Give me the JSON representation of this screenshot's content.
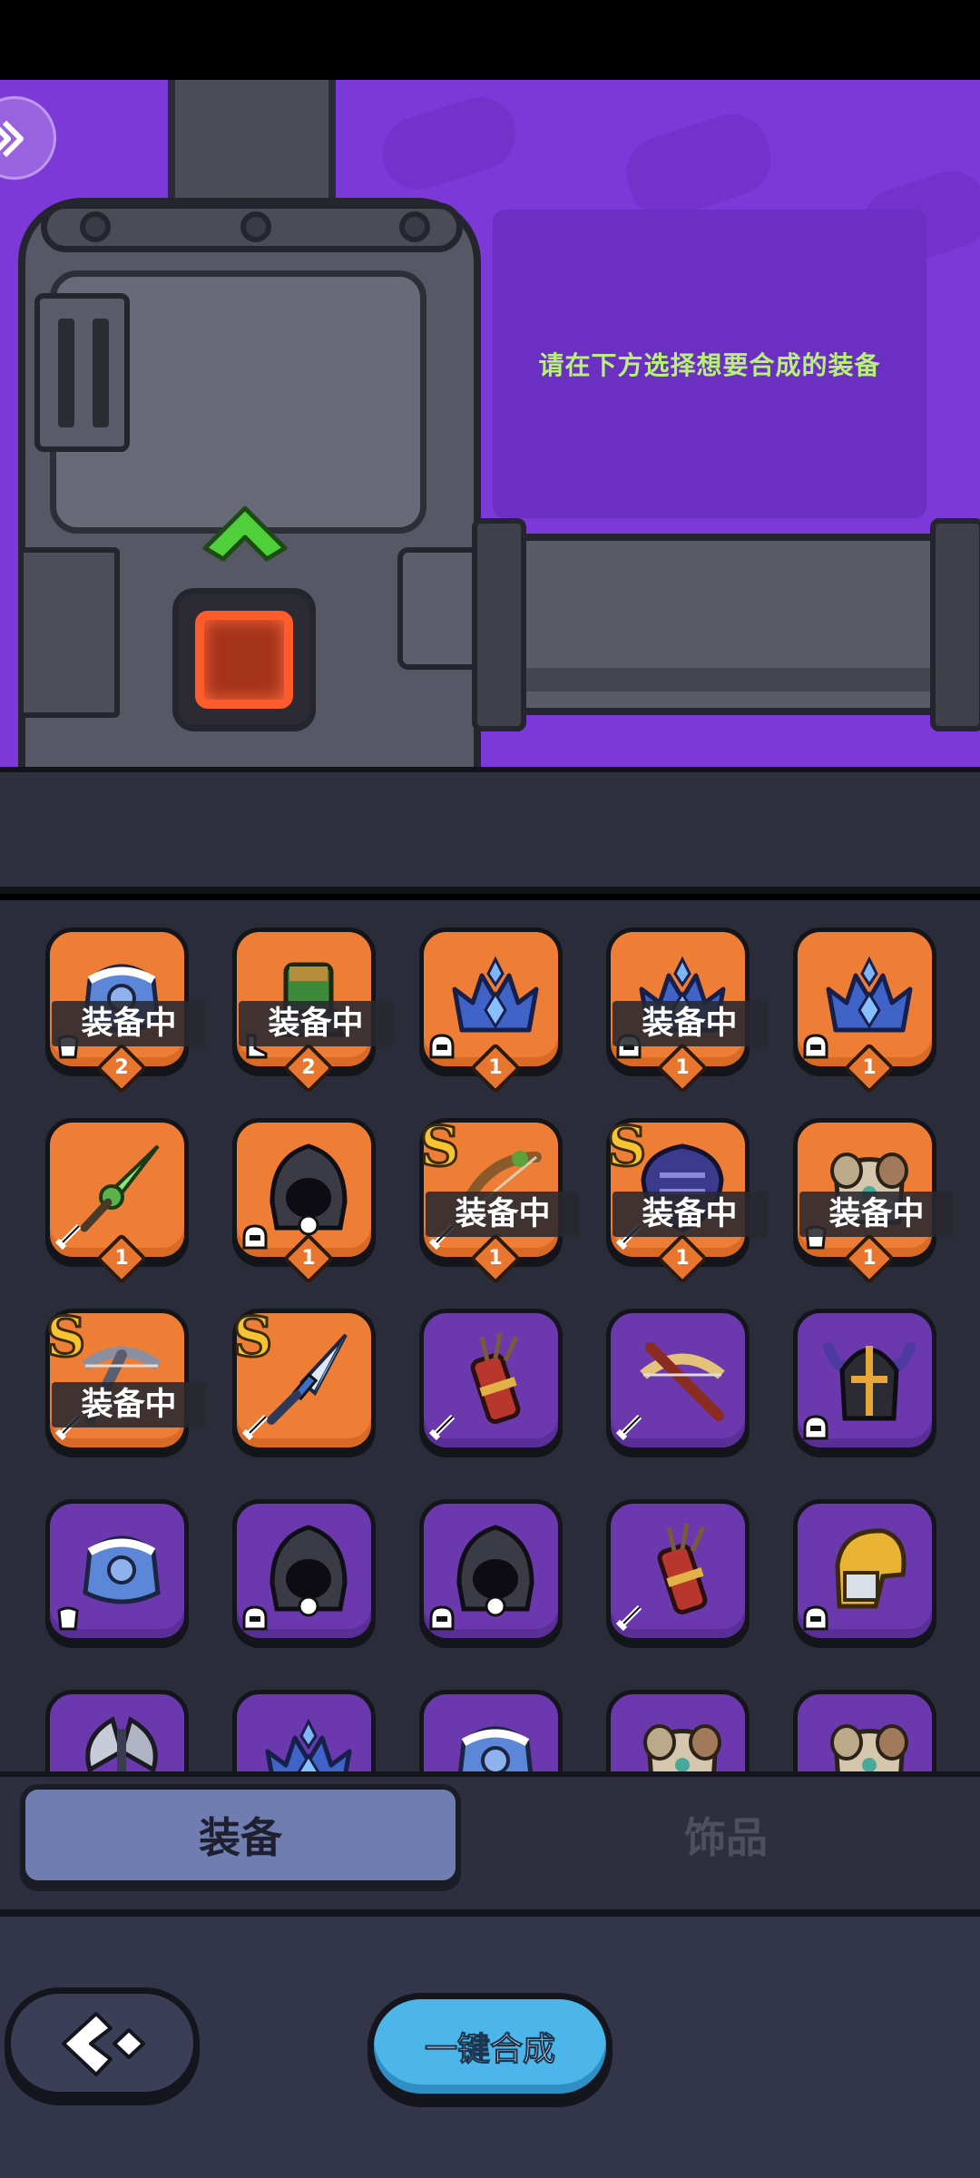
{
  "scene": {
    "hint": "请在下方选择想要合成的装备"
  },
  "inventory": {
    "equip_label": "装备中",
    "items": [
      {
        "icon": "frost-armor-icon",
        "bg": "orange",
        "equipped": true,
        "level": "2",
        "rank": "",
        "type": "armor-type-icon"
      },
      {
        "icon": "leaf-boots-icon",
        "bg": "orange",
        "equipped": true,
        "level": "2",
        "rank": "",
        "type": "boots-type-icon"
      },
      {
        "icon": "ice-crown-icon",
        "bg": "orange",
        "equipped": false,
        "level": "1",
        "rank": "",
        "type": "helmet-type-icon"
      },
      {
        "icon": "ice-crown-icon",
        "bg": "orange",
        "equipped": true,
        "level": "1",
        "rank": "",
        "type": "helmet-type-icon"
      },
      {
        "icon": "ice-crown-icon",
        "bg": "orange",
        "equipped": false,
        "level": "1",
        "rank": "",
        "type": "helmet-type-icon"
      },
      {
        "icon": "green-dagger-icon",
        "bg": "orange",
        "equipped": false,
        "level": "1",
        "rank": "",
        "type": "weapon-type-icon"
      },
      {
        "icon": "dark-hood-icon",
        "bg": "orange",
        "equipped": false,
        "level": "1",
        "rank": "",
        "type": "helmet-type-icon"
      },
      {
        "icon": "wood-bow-icon",
        "bg": "orange",
        "equipped": true,
        "level": "1",
        "rank": "S",
        "type": "weapon-type-icon"
      },
      {
        "icon": "purple-shield-icon",
        "bg": "orange",
        "equipped": true,
        "level": "1",
        "rank": "S",
        "type": "weapon-type-icon"
      },
      {
        "icon": "bone-armor-icon",
        "bg": "orange",
        "equipped": true,
        "level": "1",
        "rank": "",
        "type": "armor-type-icon"
      },
      {
        "icon": "crossbow-icon",
        "bg": "orange",
        "equipped": true,
        "level": "",
        "rank": "S",
        "type": "weapon-type-icon"
      },
      {
        "icon": "crystal-sword-icon",
        "bg": "orange",
        "equipped": false,
        "level": "",
        "rank": "S",
        "type": "weapon-type-icon"
      },
      {
        "icon": "quiver-icon",
        "bg": "purple",
        "equipped": false,
        "level": "",
        "rank": "",
        "type": "weapon-type-icon"
      },
      {
        "icon": "red-crossbow-icon",
        "bg": "purple",
        "equipped": false,
        "level": "",
        "rank": "",
        "type": "weapon-type-icon"
      },
      {
        "icon": "horned-helmet-icon",
        "bg": "purple",
        "equipped": false,
        "level": "",
        "rank": "",
        "type": "helmet-type-icon"
      },
      {
        "icon": "frost-armor-icon",
        "bg": "purple",
        "equipped": false,
        "level": "",
        "rank": "",
        "type": "armor-type-icon"
      },
      {
        "icon": "dark-hood-icon",
        "bg": "purple",
        "equipped": false,
        "level": "",
        "rank": "",
        "type": "helmet-type-icon"
      },
      {
        "icon": "dark-hood-icon",
        "bg": "purple",
        "equipped": false,
        "level": "",
        "rank": "",
        "type": "helmet-type-icon"
      },
      {
        "icon": "quiver-icon",
        "bg": "purple",
        "equipped": false,
        "level": "",
        "rank": "",
        "type": "weapon-type-icon"
      },
      {
        "icon": "gold-helmet-icon",
        "bg": "purple",
        "equipped": false,
        "level": "",
        "rank": "",
        "type": "helmet-type-icon"
      },
      {
        "icon": "axe-icon",
        "bg": "purple",
        "equipped": false,
        "level": "",
        "rank": "",
        "type": "weapon-type-icon"
      },
      {
        "icon": "ice-crown-icon",
        "bg": "purple",
        "equipped": false,
        "level": "",
        "rank": "",
        "type": "helmet-type-icon"
      },
      {
        "icon": "frost-armor-icon",
        "bg": "purple",
        "equipped": false,
        "level": "",
        "rank": "",
        "type": "armor-type-icon"
      },
      {
        "icon": "bone-armor-icon",
        "bg": "purple",
        "equipped": false,
        "level": "",
        "rank": "",
        "type": "armor-type-icon"
      },
      {
        "icon": "bone-armor-icon",
        "bg": "purple",
        "equipped": false,
        "level": "",
        "rank": "",
        "type": "armor-type-icon"
      }
    ]
  },
  "tabs": {
    "equipment": "装备",
    "accessories": "饰品"
  },
  "bottom": {
    "merge_label": "一键合成"
  },
  "colors": {
    "scene_bg": "#7d38d8",
    "hint_text": "#b9f07a",
    "orange_cell": "#ee7d35",
    "purple_cell": "#6b39ad",
    "merge_button": "#4cb5ea"
  }
}
